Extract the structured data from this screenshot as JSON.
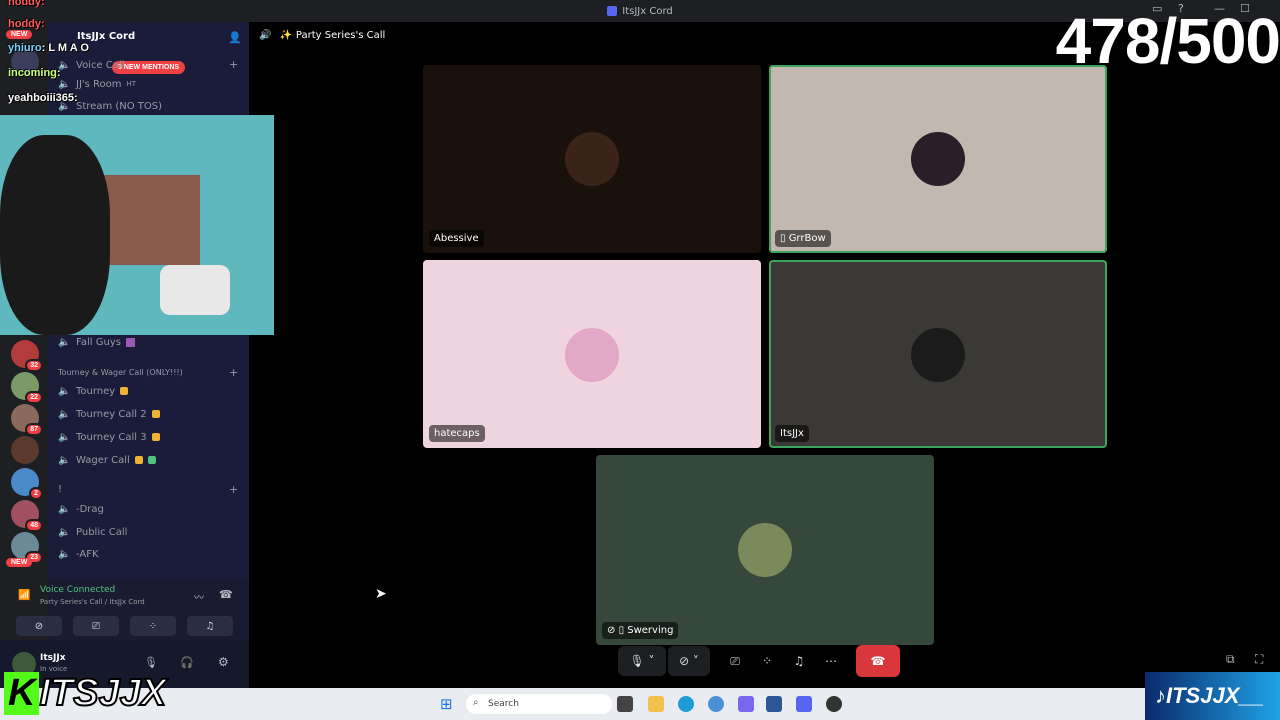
{
  "window": {
    "title": "ItsJJx Cord"
  },
  "stream_counter": "478/500",
  "chat_overlay": [
    {
      "user": "hoddy",
      "text": ""
    },
    {
      "user": "hoddy",
      "text": ""
    },
    {
      "user": "yhiuro",
      "text": "L M A O"
    },
    {
      "user": "incoming",
      "text": ""
    },
    {
      "user": "yeahboiii365",
      "text": ""
    }
  ],
  "server": {
    "name": "ItsJJx Cord",
    "new_mentions": "3 NEW MENTIONS"
  },
  "rail": {
    "new_top": "NEW",
    "new_bottom": "NEW",
    "badges": [
      "32",
      "22",
      "87",
      "",
      "2",
      "48",
      "23"
    ]
  },
  "channels_top": [
    {
      "name": "Voice Call",
      "extra": ""
    },
    {
      "name": "JJ's Room",
      "extra": "HT"
    },
    {
      "name": "Stream (NO TOS)",
      "extra": ""
    }
  ],
  "channel_fall_guys": "Fall Guys",
  "category_tourney": "Tourney & Wager Call (ONLY!!!)",
  "tourney_channels": [
    "Tourney",
    "Tourney Call 2",
    "Tourney Call 3",
    "Wager Call"
  ],
  "category_misc": "!",
  "misc_channels": [
    "-Drag",
    "Public Call",
    "-AFK"
  ],
  "voice_panel": {
    "status": "Voice Connected",
    "location": "Party Series's Call / ItsJJx Cord"
  },
  "user": {
    "name": "ItsJJx",
    "status": "In voice"
  },
  "call": {
    "channel": "Party Series's Call",
    "participants": [
      {
        "name": "Abessive",
        "mobile": false
      },
      {
        "name": "GrrBow",
        "mobile": true
      },
      {
        "name": "hatecaps",
        "mobile": false
      },
      {
        "name": "ItsJJx",
        "mobile": false
      },
      {
        "name": "Swerving",
        "mobile": true
      }
    ]
  },
  "taskbar": {
    "search_placeholder": "Search"
  },
  "brand": {
    "kick": "ITSJJX",
    "tiktok": "ITSJJX__"
  },
  "colors": {
    "accent": "#5865f2",
    "voice_green": "#4fc37f",
    "hangup": "#da373c",
    "mention": "#f23f43",
    "sidebar": "#1a1c39"
  }
}
